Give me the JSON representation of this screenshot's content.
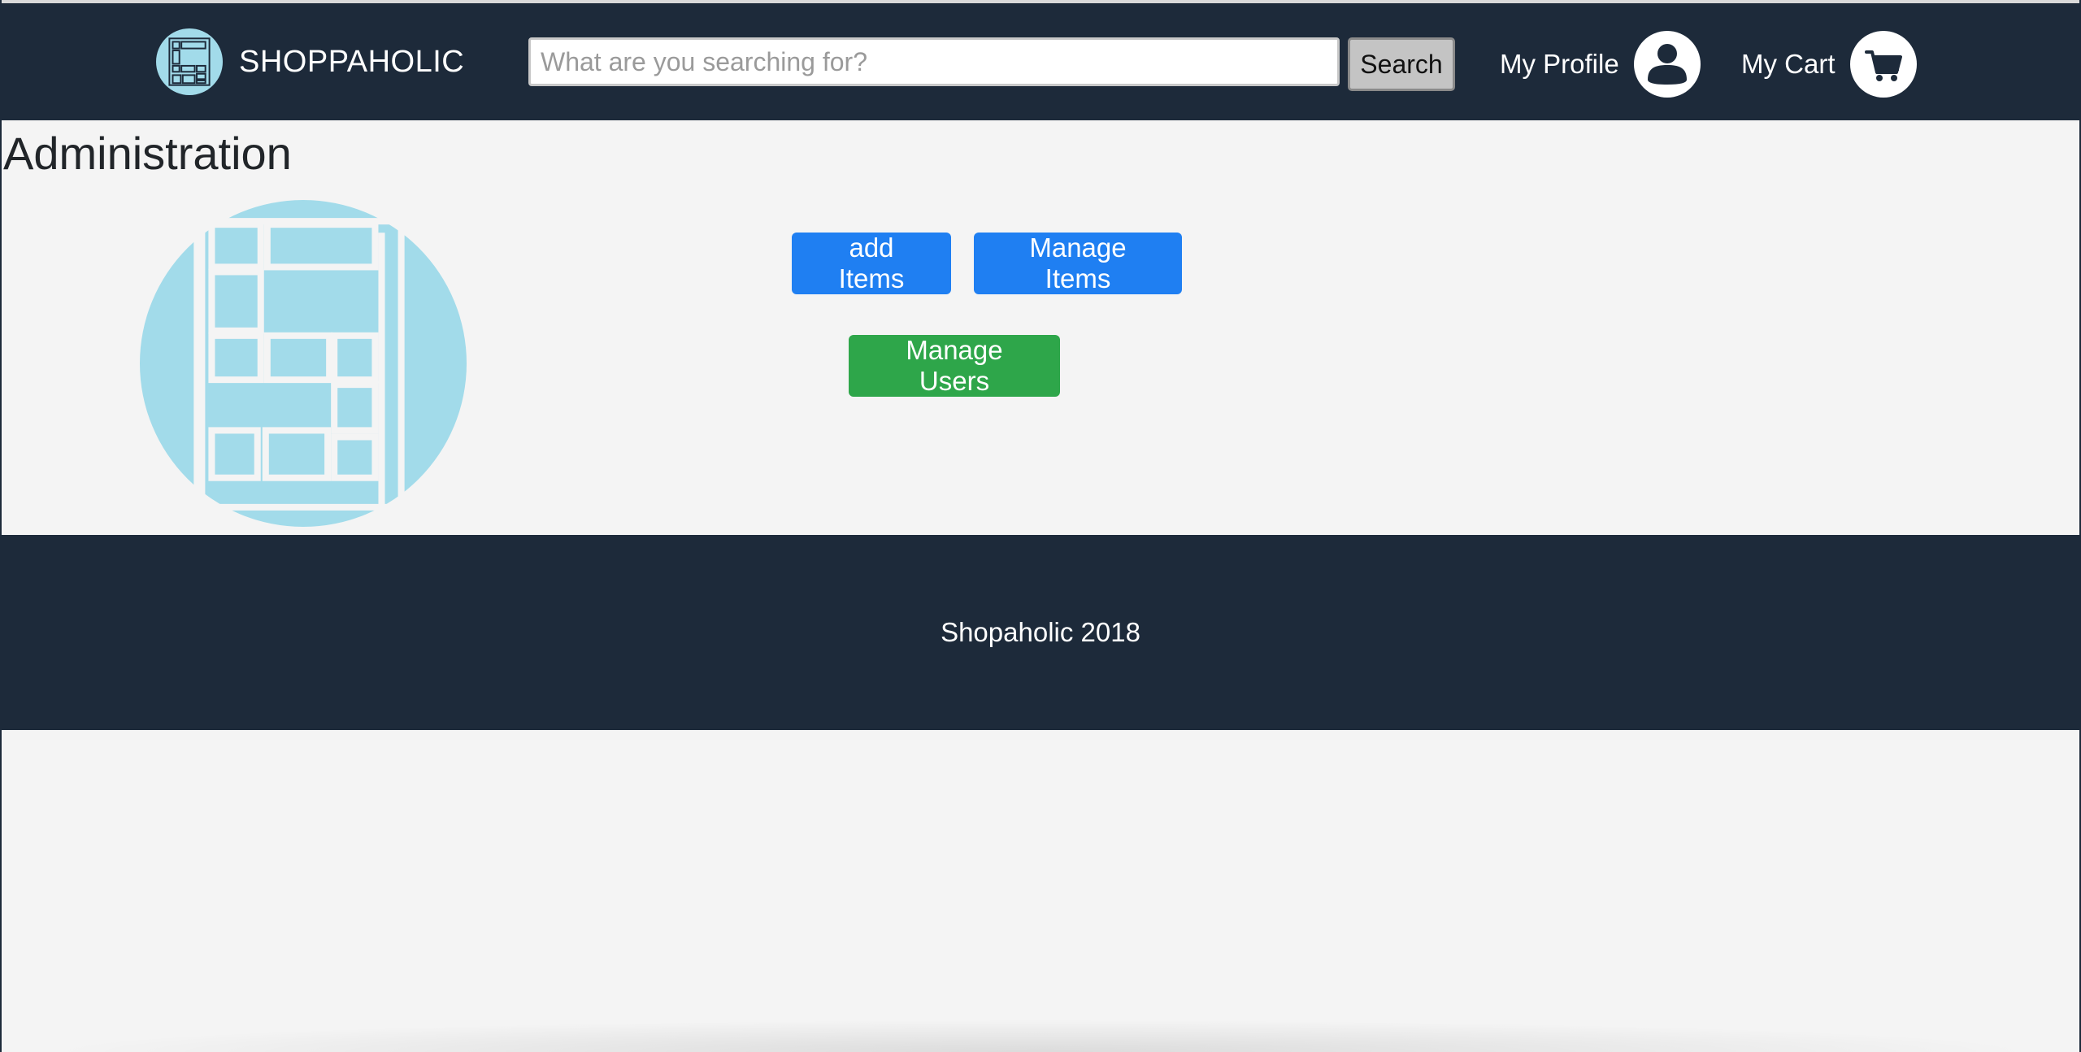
{
  "navbar": {
    "brand_name": "SHOPPAHOLIC",
    "search_placeholder": "What are you searching for?",
    "search_value": "",
    "search_button_label": "Search",
    "profile_label": "My Profile",
    "cart_label": "My Cart",
    "icons": {
      "logo": "shoppaholic-logo-icon",
      "profile": "user-icon",
      "cart": "shopping-cart-icon"
    }
  },
  "main": {
    "title": "Administration",
    "buttons": {
      "add_items": "add Items",
      "manage_items": "Manage Items",
      "manage_users": "Manage Users"
    }
  },
  "footer": {
    "text": "Shopaholic 2018"
  },
  "colors": {
    "navbar_bg": "#1d2a3a",
    "page_bg": "#f4f4f4",
    "logo_circle": "#a2dbea",
    "primary_button": "#1f7ff2",
    "success_button": "#2ea64a"
  }
}
